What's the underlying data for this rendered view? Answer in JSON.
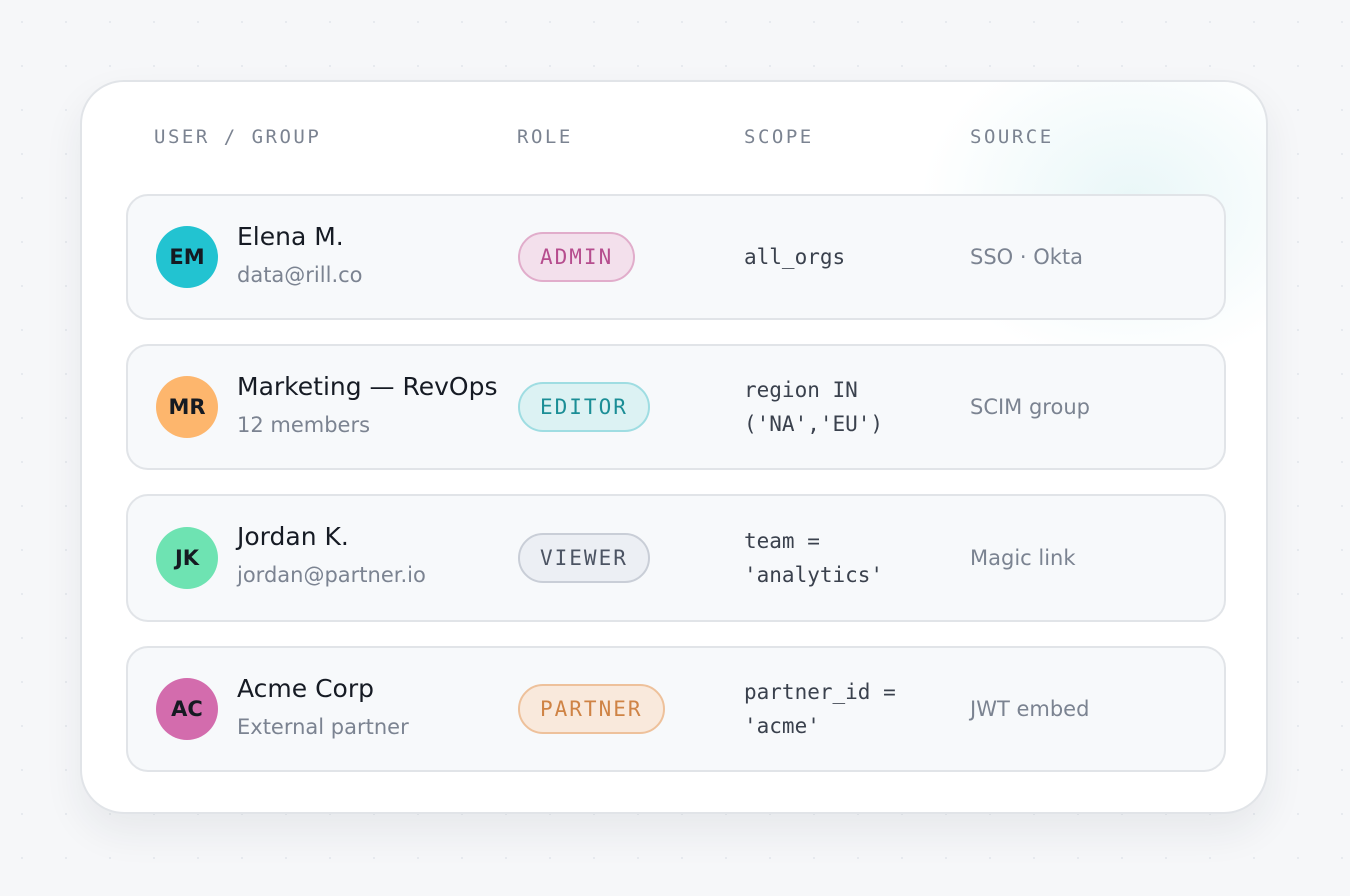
{
  "header": {
    "user_group": "USER / GROUP",
    "role": "ROLE",
    "scope": "SCOPE",
    "source": "SOURCE"
  },
  "rows": [
    {
      "initials": "EM",
      "avatar_color": "#22c3d1",
      "name": "Elena M.",
      "subtitle": "data@rill.co",
      "role": "ADMIN",
      "role_colors": {
        "bg": "#f3e0ec",
        "border": "#e1adcb",
        "text": "#b64d8e"
      },
      "scope": "all_orgs",
      "source": "SSO · Okta"
    },
    {
      "initials": "MR",
      "avatar_color": "#fdb66d",
      "name": "Marketing — RevOps",
      "subtitle": "12 members",
      "role": "EDITOR",
      "role_colors": {
        "bg": "#dcf2f3",
        "border": "#9fdde2",
        "text": "#1b8e96"
      },
      "scope": "region IN ('NA','EU')",
      "source": "SCIM group"
    },
    {
      "initials": "JK",
      "avatar_color": "#6ee3b2",
      "name": "Jordan K.",
      "subtitle": "jordan@partner.io",
      "role": "VIEWER",
      "role_colors": {
        "bg": "#eceff4",
        "border": "#c9ced7",
        "text": "#4c5463"
      },
      "scope": "team = 'analytics'",
      "source": "Magic link"
    },
    {
      "initials": "AC",
      "avatar_color": "#d36cad",
      "name": "Acme Corp",
      "subtitle": "External partner",
      "role": "PARTNER",
      "role_colors": {
        "bg": "#f9e9dc",
        "border": "#eec19b",
        "text": "#cf8345"
      },
      "scope": "partner_id = 'acme'",
      "source": "JWT embed"
    }
  ]
}
